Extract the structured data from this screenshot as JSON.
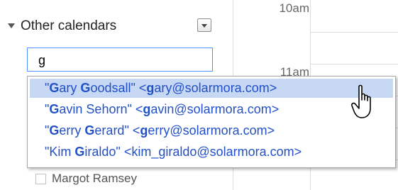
{
  "sidebar": {
    "section_title": "Other calendars",
    "search": {
      "value": "g"
    },
    "calendars": [
      {
        "name": "Margot Ramsey"
      }
    ]
  },
  "grid": {
    "hours": [
      {
        "label": "10am"
      },
      {
        "label": "11am"
      }
    ]
  },
  "autocomplete": {
    "selected_index": 0,
    "suggestions": [
      {
        "parts": [
          "\"",
          "G",
          "ary ",
          "G",
          "oodsall\" <",
          "g",
          "ary@solarmora.com>"
        ]
      },
      {
        "parts": [
          "\"",
          "G",
          "avin Sehorn\" <",
          "g",
          "avin@solarmora.com>"
        ]
      },
      {
        "parts": [
          "\"",
          "G",
          "erry ",
          "G",
          "erard\" <",
          "g",
          "erry@solarmora.com>"
        ]
      },
      {
        "parts": [
          "\"Kim ",
          "G",
          "iraldo\" <kim_giraldo@solarmora.com>"
        ]
      }
    ]
  },
  "colors": {
    "link_blue": "#2250c8",
    "highlight": "#c6d8f4",
    "focus_border": "#4d90fe"
  },
  "icons": {
    "collapse": "triangle-down-icon",
    "options": "dropdown-arrow-icon",
    "cursor": "hand-pointer-icon"
  }
}
